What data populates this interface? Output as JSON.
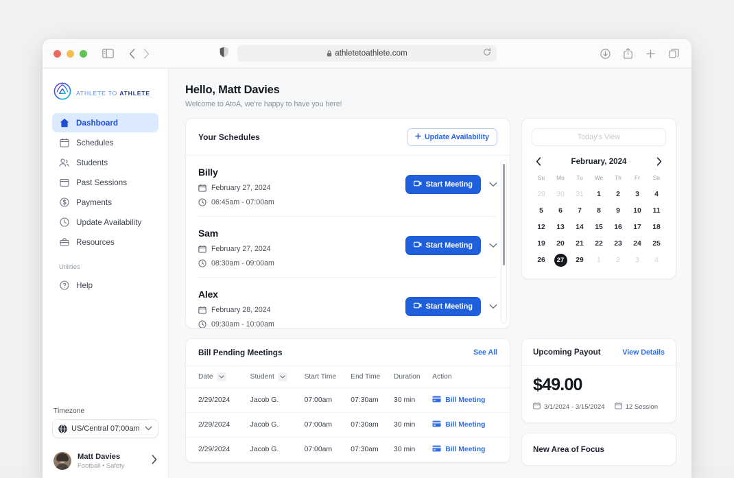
{
  "browser": {
    "url": "athletetoathlete.com",
    "icons": {
      "sidebar_toggle": "sidebar-toggle-icon",
      "back": "back-arrow-icon",
      "forward": "forward-arrow-icon",
      "shield": "shield-icon",
      "lock": "lock-icon",
      "reload": "reload-icon",
      "downloads": "download-icon",
      "share": "share-icon",
      "new_tab": "plus-icon",
      "tabs": "tabs-icon"
    }
  },
  "sidebar": {
    "logo": {
      "light": "ATHLETE TO ",
      "bold": "ATHLETE"
    },
    "items": [
      {
        "label": "Dashboard",
        "icon": "home-icon",
        "active": true
      },
      {
        "label": "Schedules",
        "icon": "calendar-icon",
        "active": false
      },
      {
        "label": "Students",
        "icon": "users-icon",
        "active": false
      },
      {
        "label": "Past Sessions",
        "icon": "archive-icon",
        "active": false
      },
      {
        "label": "Payments",
        "icon": "dollar-circle-icon",
        "active": false
      },
      {
        "label": "Update Availability",
        "icon": "clock-icon",
        "active": false
      },
      {
        "label": "Resources",
        "icon": "briefcase-icon",
        "active": false
      }
    ],
    "section_label": "Utilities",
    "utilities": [
      {
        "label": "Help",
        "icon": "question-circle-icon",
        "active": false
      }
    ],
    "timezone": {
      "label": "Timezone",
      "value": "US/Central  07:00am",
      "icon": "globe-icon"
    },
    "user": {
      "name": "Matt Davies",
      "subtitle": "Football • Safety"
    }
  },
  "main": {
    "greeting_title": "Hello, Matt Davies",
    "greeting_subtitle": "Welcome to AtoA, we're happy to have you here!",
    "schedules": {
      "title": "Your Schedules",
      "update_button": "Update Availability",
      "items": [
        {
          "name": "Billy",
          "date": "February 27, 2024",
          "time": "06:45am - 07:00am",
          "action": "Start Meeting"
        },
        {
          "name": "Sam",
          "date": "February 27, 2024",
          "time": "08:30am - 09:00am",
          "action": "Start Meeting"
        },
        {
          "name": "Alex",
          "date": "February 28, 2024",
          "time": "09:30am - 10:00am",
          "action": "Start Meeting"
        }
      ]
    },
    "calendar": {
      "today_button": "Today's View",
      "month": "February, 2024",
      "dow": [
        "Su",
        "Mo",
        "Tu",
        "We",
        "Th",
        "Fr",
        "Sa"
      ],
      "weeks": [
        [
          {
            "d": "29",
            "m": true
          },
          {
            "d": "30",
            "m": true
          },
          {
            "d": "31",
            "m": true
          },
          {
            "d": "1"
          },
          {
            "d": "2"
          },
          {
            "d": "3"
          },
          {
            "d": "4"
          }
        ],
        [
          {
            "d": "5"
          },
          {
            "d": "6"
          },
          {
            "d": "7"
          },
          {
            "d": "8"
          },
          {
            "d": "9"
          },
          {
            "d": "10"
          },
          {
            "d": "11"
          }
        ],
        [
          {
            "d": "12"
          },
          {
            "d": "13"
          },
          {
            "d": "14"
          },
          {
            "d": "15"
          },
          {
            "d": "16"
          },
          {
            "d": "17"
          },
          {
            "d": "18"
          }
        ],
        [
          {
            "d": "19"
          },
          {
            "d": "20"
          },
          {
            "d": "21"
          },
          {
            "d": "22"
          },
          {
            "d": "23"
          },
          {
            "d": "24"
          },
          {
            "d": "25"
          }
        ],
        [
          {
            "d": "26"
          },
          {
            "d": "27",
            "sel": true
          },
          {
            "d": "29"
          },
          {
            "d": "1",
            "m": true
          },
          {
            "d": "2",
            "m": true
          },
          {
            "d": "3",
            "m": true
          },
          {
            "d": "4",
            "m": true
          }
        ]
      ]
    },
    "pending": {
      "title": "Bill Pending Meetings",
      "see_all": "See All",
      "columns": [
        "Date",
        "Student",
        "Start Time",
        "End Time",
        "Duration",
        "Action"
      ],
      "sortable": [
        "Date",
        "Student"
      ],
      "rows": [
        {
          "date": "2/29/2024",
          "student": "Jacob G.",
          "start": "07:00am",
          "end": "07:30am",
          "duration": "30 min",
          "action": "Bill Meeting"
        },
        {
          "date": "2/29/2024",
          "student": "Jacob G.",
          "start": "07:00am",
          "end": "07:30am",
          "duration": "30 min",
          "action": "Bill Meeting"
        },
        {
          "date": "2/29/2024",
          "student": "Jacob G.",
          "start": "07:00am",
          "end": "07:30am",
          "duration": "30 min",
          "action": "Bill Meeting"
        }
      ]
    },
    "payout": {
      "title": "Upcoming Payout",
      "view_details": "View Details",
      "amount": "$49.00",
      "date_range": "3/1/2024 - 3/15/2024",
      "sessions": "12 Session"
    },
    "focus": {
      "title": "New Area of Focus"
    }
  },
  "colors": {
    "accent_blue": "#1f5fdb",
    "link_blue": "#2f6fe4",
    "active_nav_bg": "#dbeafe",
    "active_nav_text": "#1d4ed8",
    "page_bg": "#f7f8fa",
    "selected_day": "#14181f"
  }
}
